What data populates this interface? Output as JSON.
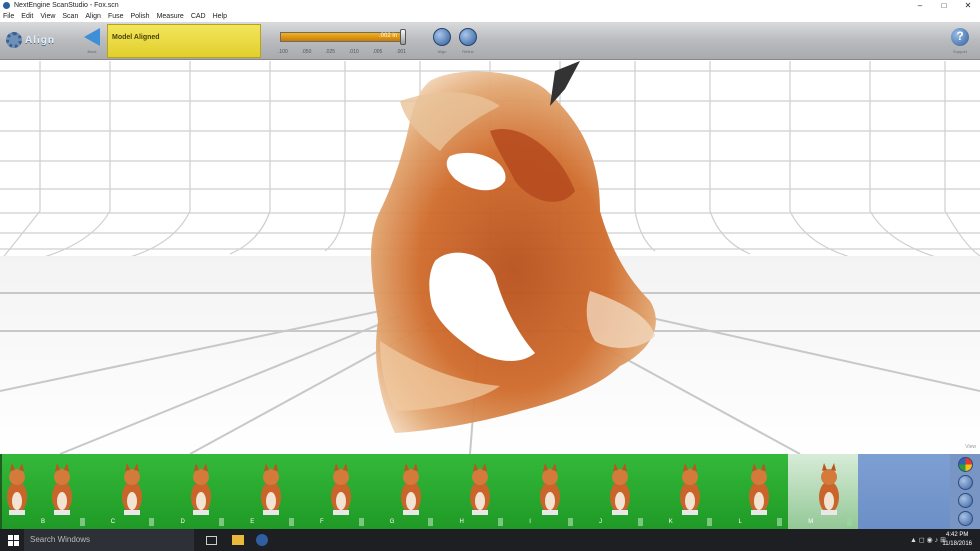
{
  "window": {
    "title": "NextEngine ScanStudio - Fox.scn",
    "controls": [
      "–",
      "□",
      "✕"
    ]
  },
  "menu": [
    "File",
    "Edit",
    "View",
    "Scan",
    "Align",
    "Fuse",
    "Polish",
    "Measure",
    "CAD",
    "Help"
  ],
  "toolbar": {
    "mode_title": "Align",
    "back_label": "Back",
    "status_text": "Model Aligned",
    "tolerance_value": ".002 in",
    "tolerance_ticks": [
      ".100",
      ".050",
      ".025",
      ".010",
      ".005",
      ".001"
    ],
    "align_label": "Align",
    "refine_label": "Refine",
    "help_label": "Support"
  },
  "viewport": {
    "view_label": "View"
  },
  "thumbnails": [
    {
      "letter": "B",
      "selected": false
    },
    {
      "letter": "C",
      "selected": false
    },
    {
      "letter": "D",
      "selected": false
    },
    {
      "letter": "E",
      "selected": false
    },
    {
      "letter": "F",
      "selected": false
    },
    {
      "letter": "G",
      "selected": false
    },
    {
      "letter": "H",
      "selected": false
    },
    {
      "letter": "I",
      "selected": false
    },
    {
      "letter": "J",
      "selected": false
    },
    {
      "letter": "K",
      "selected": false
    },
    {
      "letter": "L",
      "selected": false
    },
    {
      "letter": "M",
      "selected": true
    }
  ],
  "taskbar": {
    "search_placeholder": "Search Windows",
    "time": "4:42 PM",
    "date": "11/18/2016"
  },
  "colors": {
    "accent_yellow": "#e8d63a",
    "thumb_green": "#2aa831",
    "scan_orange": "#c4561c",
    "slider_orange": "#e89a13"
  }
}
